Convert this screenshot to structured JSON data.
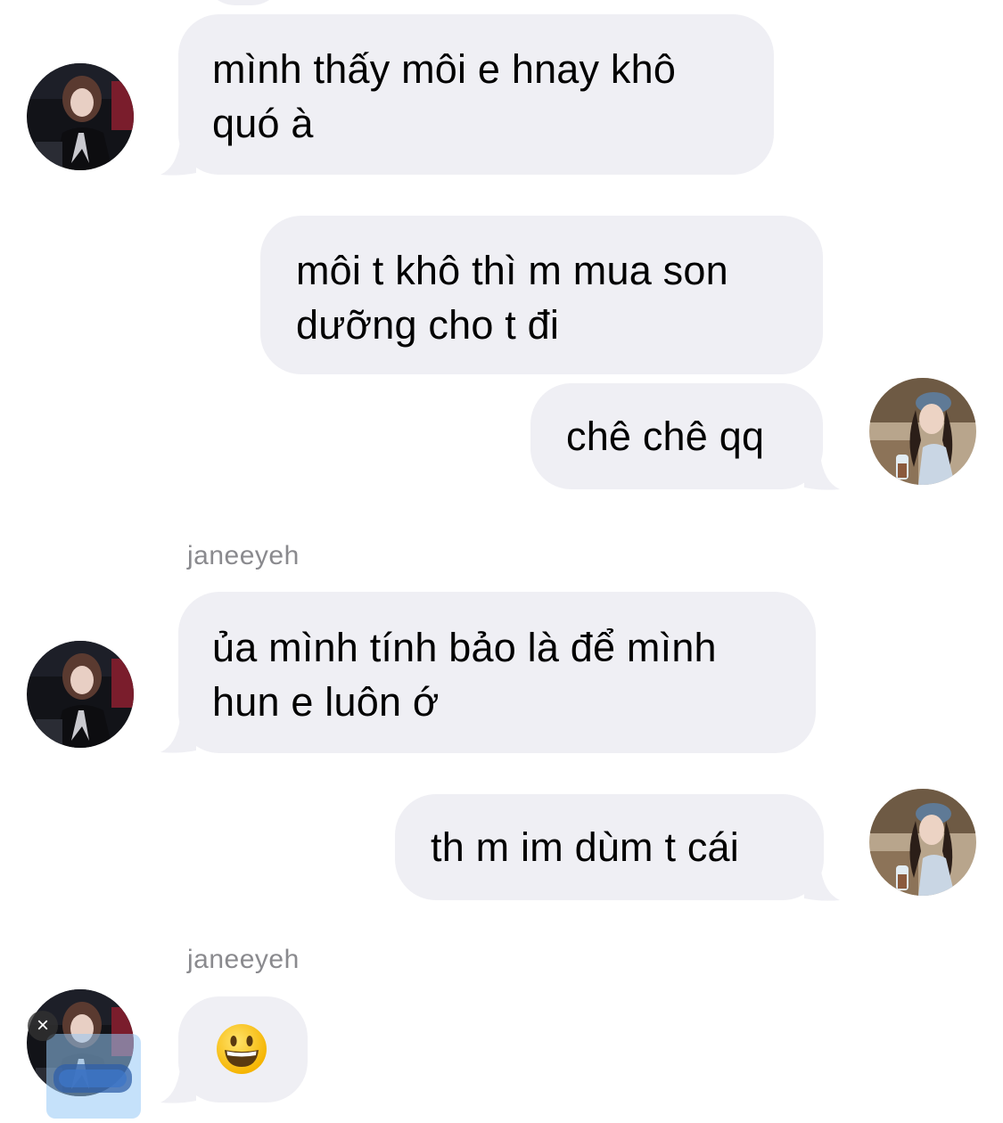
{
  "conversation": {
    "messages": [
      {
        "direction": "incoming",
        "text": "mình thấy môi e hnay khô quó à"
      },
      {
        "direction": "outgoing",
        "text": "môi t khô thì m mua son dưỡng cho t đi"
      },
      {
        "direction": "outgoing",
        "text": "chê chê qq"
      },
      {
        "direction": "incoming",
        "sender": "janeeyeh",
        "text": "ủa mình tính bảo là để mình hun e luôn ớ"
      },
      {
        "direction": "outgoing",
        "text": "th m im dùm t cái"
      },
      {
        "direction": "incoming",
        "sender": "janeeyeh",
        "emoji": "grinning-face"
      }
    ]
  },
  "colors": {
    "incoming_bubble": "#efeff4",
    "outgoing_bubble": "#efeff4",
    "sender_name": "#8a8a8e",
    "background": "#ffffff"
  },
  "icons": {
    "overlay_close": "×",
    "overlay_close_name": "close-icon"
  }
}
